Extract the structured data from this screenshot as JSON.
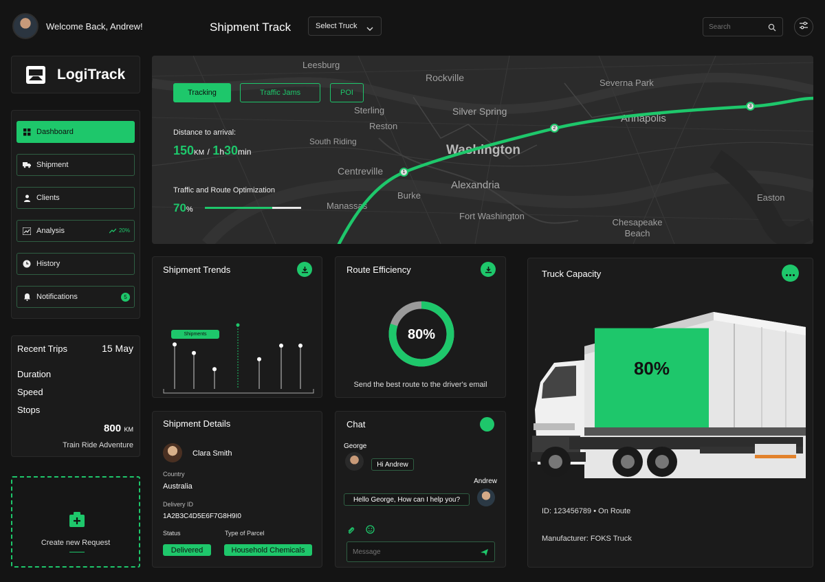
{
  "user": {
    "greeting": "Welcome Back, Andrew!"
  },
  "header": {
    "title": "Shipment Track",
    "select_truck": "Select Truck",
    "search_placeholder": "Search"
  },
  "brand": {
    "name": "LogiTrack"
  },
  "sidebar": {
    "items": [
      {
        "label": "Dashboard",
        "icon": "grid-icon"
      },
      {
        "label": "Shipment",
        "icon": "truck-icon"
      },
      {
        "label": "Clients",
        "icon": "user-icon"
      },
      {
        "label": "Analysis",
        "icon": "chart-icon",
        "badge": "20%"
      },
      {
        "label": "History",
        "icon": "clock-icon"
      },
      {
        "label": "Notifications",
        "icon": "bell-icon",
        "badge": "5"
      }
    ]
  },
  "recent_trips": {
    "title": "Recent Trips",
    "date": "15 May",
    "rows": [
      "Duration",
      "Speed",
      "Stops"
    ],
    "distance_value": "800",
    "distance_unit": "KM",
    "trip_name": "Train Ride Adventure"
  },
  "create_request": {
    "label": "Create new Request"
  },
  "map": {
    "tabs": [
      "Tracking",
      "Traffic Jams",
      "POI"
    ],
    "distance_label": "Distance to arrival:",
    "distance_km": "150",
    "distance_km_unit": "KM",
    "sep": "/",
    "hours": "1",
    "hours_unit": "h",
    "minutes": "30",
    "minutes_unit": "min",
    "optimization_label": "Traffic and Route Optimization",
    "optimization_value": "70",
    "optimization_unit": "%",
    "optimization_fraction": 0.7,
    "places": [
      "Leesburg",
      "Rockville",
      "Severna Park",
      "Sterling",
      "Silver Spring",
      "Reston",
      "Annapolis",
      "South Riding",
      "Washington",
      "Centreville",
      "Alexandria",
      "Burke",
      "Manassas",
      "Fort Washington",
      "Chesapeake Beach",
      "Easton"
    ],
    "route_points": [
      "1",
      "2",
      "3"
    ]
  },
  "shipment_trends": {
    "title": "Shipment Trends",
    "tooltip": "Shipments",
    "values": [
      3.6,
      2.9,
      1.6,
      2.4,
      3.5,
      3.5
    ]
  },
  "route_efficiency": {
    "title": "Route Efficiency",
    "value": "80%",
    "fraction": 0.8,
    "caption": "Send the best route to the driver's email"
  },
  "truck_capacity": {
    "title": "Truck Capacity",
    "value": "80%",
    "fraction": 0.8,
    "id_line": "ID: 123456789 • On Route",
    "manufacturer_line": "Manufacturer: FOKS Truck"
  },
  "shipment_details": {
    "title": "Shipment Details",
    "client_name": "Clara Smith",
    "country_label": "Country",
    "country_value": "Australia",
    "delivery_id_label": "Delivery ID",
    "delivery_id_value": "1A2B3C4D5E6F7G8H9I0",
    "status_label": "Status",
    "status_value": "Delivered",
    "parcel_label": "Type of Parcel",
    "parcel_value": "Household Chemicals"
  },
  "chat": {
    "title": "Chat",
    "sender_left": "George",
    "msg_left": "Hi Andrew",
    "sender_right": "Andrew",
    "msg_right": "Hello George, How can I help you?",
    "input_placeholder": "Message"
  },
  "colors": {
    "accent": "#1ec76b",
    "bg": "#141414",
    "card": "#1b1b1b"
  }
}
